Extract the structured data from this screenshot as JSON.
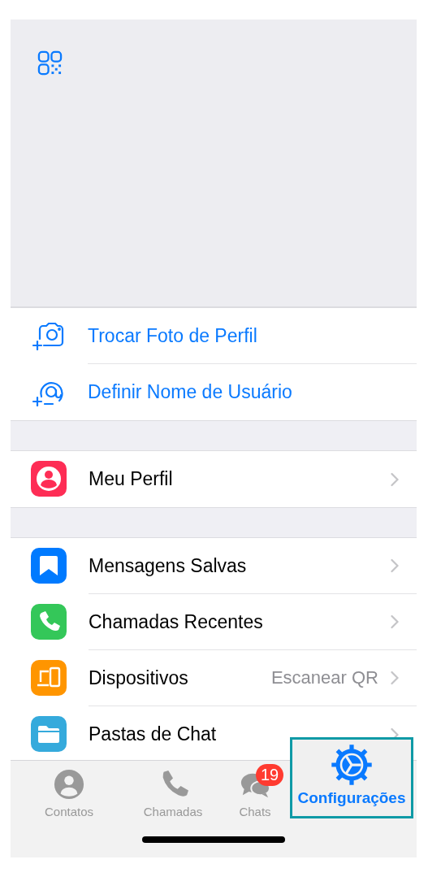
{
  "profile_actions": [
    {
      "kind": "camera",
      "label": "Trocar Foto de Perfil"
    },
    {
      "kind": "at",
      "label": "Definir Nome de Usuário"
    }
  ],
  "sections": [
    [
      {
        "kind": "person",
        "color": "#fe2d55",
        "label": "Meu Perfil"
      }
    ],
    [
      {
        "kind": "bookmark",
        "color": "#007aff",
        "label": "Mensagens Salvas"
      },
      {
        "kind": "phone",
        "color": "#34c759",
        "label": "Chamadas Recentes"
      },
      {
        "kind": "devices",
        "color": "#ff9500",
        "label": "Dispositivos",
        "value": "Escanear QR"
      },
      {
        "kind": "folder",
        "color": "#35aadc",
        "label": "Pastas de Chat"
      }
    ]
  ],
  "tabs": [
    {
      "kind": "person",
      "label": "Contatos",
      "selected": false
    },
    {
      "kind": "phone",
      "label": "Chamadas",
      "selected": false
    },
    {
      "kind": "chats",
      "label": "Chats",
      "selected": false,
      "badge": "19"
    },
    {
      "kind": "gear",
      "label": "Configurações",
      "selected": true
    }
  ]
}
